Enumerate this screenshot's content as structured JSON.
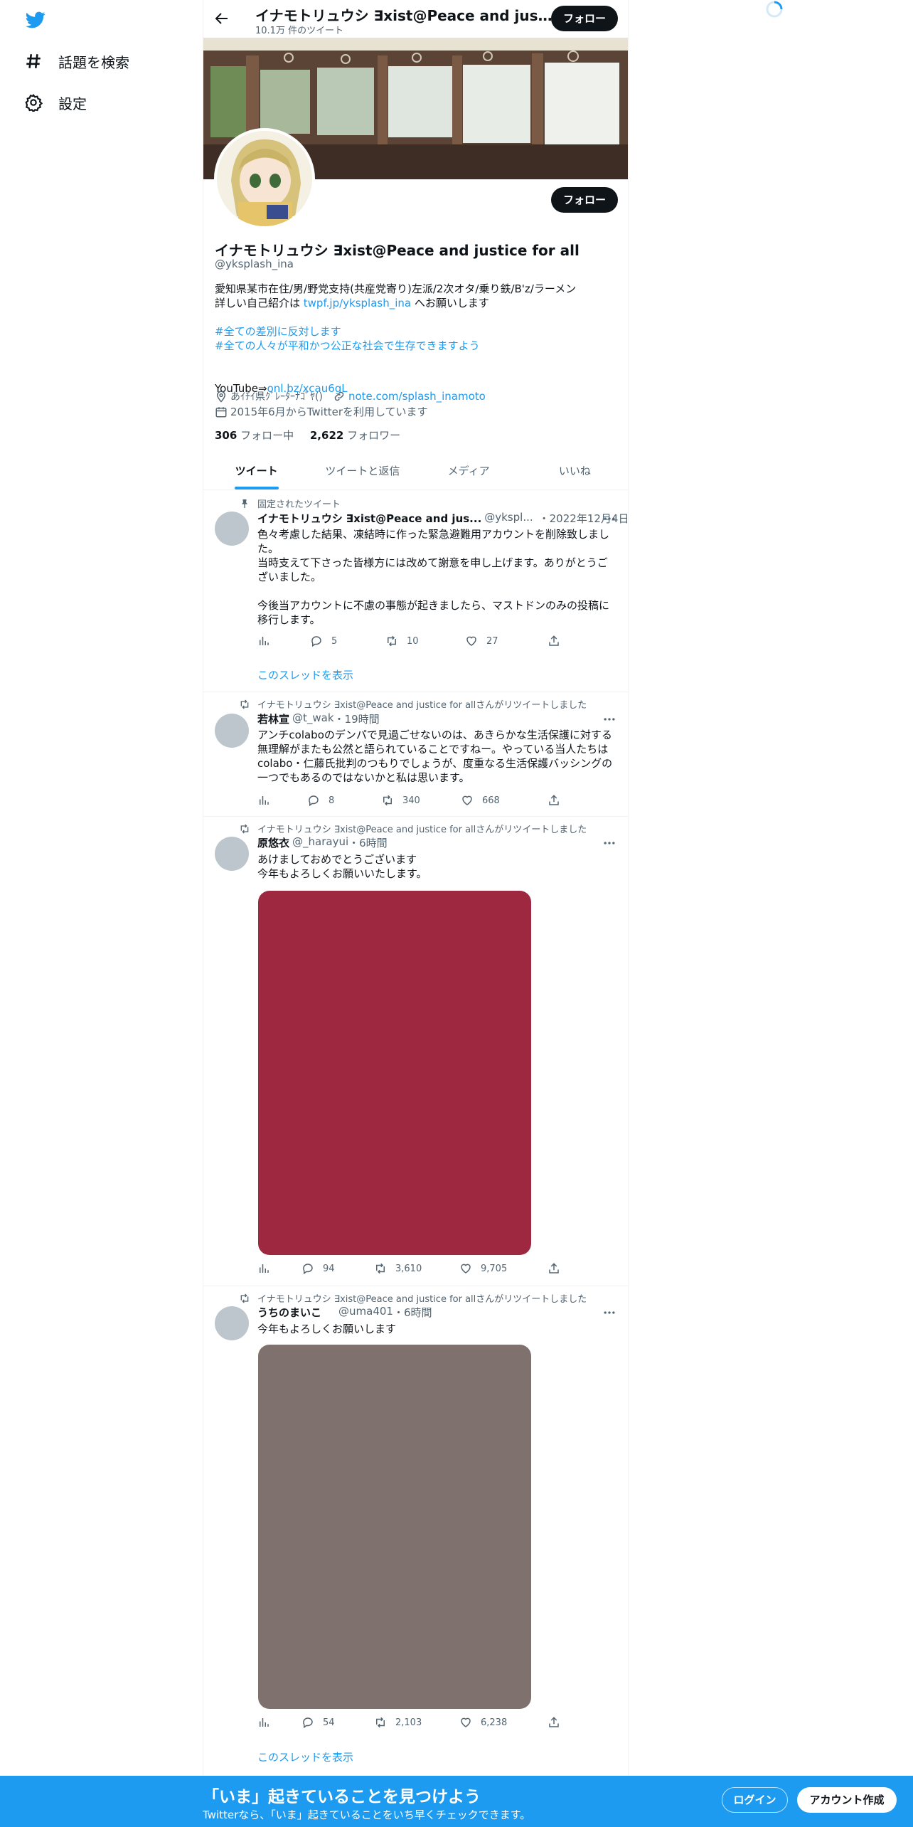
{
  "nav": {
    "explore": "話題を検索",
    "settings": "設定"
  },
  "header": {
    "name": "イナモトリュウシ ∃xist@Peace and justice for all",
    "tweet_count": "10.1万 件のツイート",
    "follow": "フォロー"
  },
  "profile": {
    "follow": "フォロー",
    "name": "イナモトリュウシ ∃xist@Peace and justice for all",
    "handle": "@yksplash_ina",
    "bio_line1": "愛知県某市在住/男/野党支持(共産党寄り)左派/2次オタ/乗り鉄/B'z/ラーメン",
    "bio_line2_prefix": "詳しい自己紹介は ",
    "bio_line2_link": "twpf.jp/yksplash_ina",
    "bio_line2_suffix": " へお願いします",
    "hashtag1": "#全ての差別に反対します",
    "hashtag2": "#全ての人々が平和かつ公正な社会で生存できますよう",
    "youtube_prefix": "YouTube⇒",
    "youtube_link": "onl.bz/xcau6gL",
    "location": "あｲﾁｲ県ｸﾞﾚｰﾀｰﾅｺﾞﾔ()",
    "website": "note.com/splash_inamoto",
    "joined": "2015年6月からTwitterを利用しています",
    "following_count": "306",
    "following_label": " フォロー中",
    "followers_count": "2,622",
    "followers_label": " フォロワー"
  },
  "tabs": [
    "ツイート",
    "ツイートと返信",
    "メディア",
    "いいね"
  ],
  "tweets": [
    {
      "social": "固定されたツイート",
      "name": "イナモトリュウシ ∃xist@Peace and jus...",
      "handle": "@ykspl...",
      "time": "・2022年12月4日",
      "lines": [
        "色々考慮した結果、凍結時に作った緊急避難用アカウントを削除致しまし",
        "た。",
        "当時支えて下さった皆様方には改めて謝意を申し上げます。ありがとうご",
        "ざいました。",
        "",
        "今後当アカウントに不慮の事態が起きましたら、マストドンのみの投稿に",
        "移行します。"
      ],
      "replies": "5",
      "retweets": "10",
      "likes": "27",
      "thread": "このスレッドを表示"
    },
    {
      "social": "イナモトリュウシ ∃xist@Peace and justice for allさんがリツイートしました",
      "name": "若林宣",
      "handle": "@t_wak",
      "time": "・19時間",
      "lines": [
        "アンチcolaboのデンパで見過ごせないのは、あきらかな生活保護に対する",
        "無理解がまたも公然と語られていることですねー。やっている当人たちは",
        "colabo・仁藤氏批判のつもりでしょうが、度重なる生活保護バッシングの",
        "一つでもあるのではないかと私は思います。"
      ],
      "replies": "8",
      "retweets": "340",
      "likes": "668"
    },
    {
      "social": "イナモトリュウシ ∃xist@Peace and justice for allさんがリツイートしました",
      "name": "原悠衣",
      "handle": "@_harayui",
      "time": "・6時間",
      "lines": [
        "あけましておめでとうございます",
        "今年もよろしくお願いいたします。"
      ],
      "media_color": "#9e2840",
      "replies": "94",
      "retweets": "3,610",
      "likes": "9,705"
    },
    {
      "social": "イナモトリュウシ ∃xist@Peace and justice for allさんがリツイートしました",
      "name": "うちのまいこ",
      "handle": "@uma401",
      "time": "・6時間",
      "lines": [
        "今年もよろしくお願いします"
      ],
      "media_color": "#7f716d",
      "replies": "54",
      "retweets": "2,103",
      "likes": "6,238",
      "thread": "このスレッドを表示"
    }
  ],
  "bottom": {
    "title": "「いま」起きていることを見つけよう",
    "subtitle": "Twitterなら、「いま」起きていることをいち早くチェックできます。",
    "login": "ログイン",
    "signup": "アカウント作成"
  },
  "colors": {
    "accent": "#1d9bf0",
    "dark": "#0f1419",
    "muted": "#536471"
  }
}
